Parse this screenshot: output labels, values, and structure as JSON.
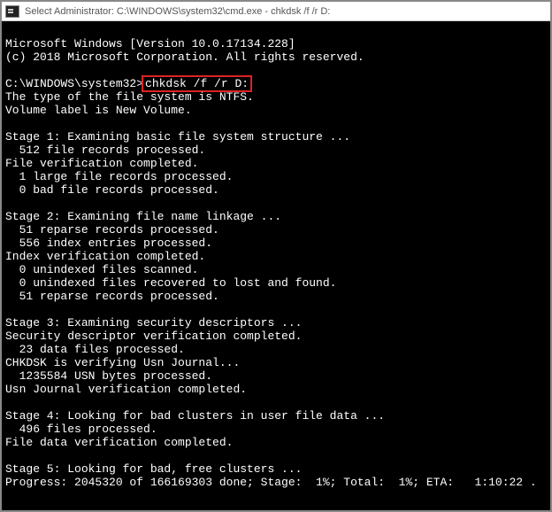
{
  "titlebar": {
    "text": "Select Administrator: C:\\WINDOWS\\system32\\cmd.exe - chkdsk  /f /r D:"
  },
  "lines": {
    "l1": "Microsoft Windows [Version 10.0.17134.228]",
    "l2": "(c) 2018 Microsoft Corporation. All rights reserved.",
    "blank1": "",
    "prompt": "C:\\WINDOWS\\system32>",
    "cmd": "chkdsk /f /r D:",
    "l4": "The type of the file system is NTFS.",
    "l5": "Volume label is New Volume.",
    "blank2": "",
    "l6": "Stage 1: Examining basic file system structure ...",
    "l7": "  512 file records processed.",
    "l8": "File verification completed.",
    "l9": "  1 large file records processed.",
    "l10": "  0 bad file records processed.",
    "blank3": "",
    "l11": "Stage 2: Examining file name linkage ...",
    "l12": "  51 reparse records processed.",
    "l13": "  556 index entries processed.",
    "l14": "Index verification completed.",
    "l15": "  0 unindexed files scanned.",
    "l16": "  0 unindexed files recovered to lost and found.",
    "l17": "  51 reparse records processed.",
    "blank4": "",
    "l18": "Stage 3: Examining security descriptors ...",
    "l19": "Security descriptor verification completed.",
    "l20": "  23 data files processed.",
    "l21": "CHKDSK is verifying Usn Journal...",
    "l22": "  1235584 USN bytes processed.",
    "l23": "Usn Journal verification completed.",
    "blank5": "",
    "l24": "Stage 4: Looking for bad clusters in user file data ...",
    "l25": "  496 files processed.",
    "l26": "File data verification completed.",
    "blank6": "",
    "l27": "Stage 5: Looking for bad, free clusters ...",
    "l28": "Progress: 2045320 of 166169303 done; Stage:  1%; Total:  1%; ETA:   1:10:22 ."
  }
}
